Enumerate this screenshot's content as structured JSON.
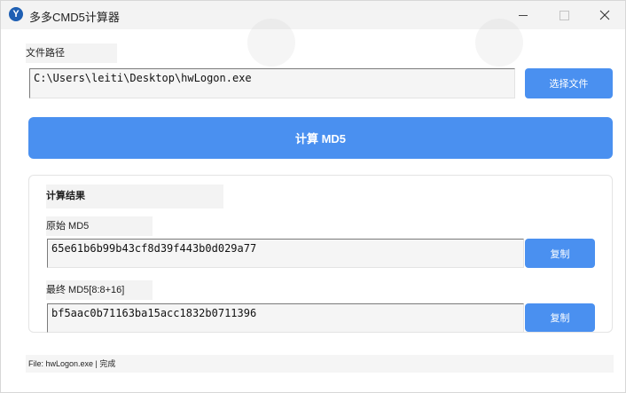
{
  "window": {
    "title": "多多CMD5计算器",
    "icon_letter": "Y"
  },
  "file_path": {
    "label": "文件路径",
    "value": "C:\\Users\\leiti\\Desktop\\hwLogon.exe",
    "browse_label": "选择文件"
  },
  "compute_button": {
    "label": "计算 MD5"
  },
  "results": {
    "title": "计算结果",
    "original": {
      "label": "原始 MD5",
      "value": "65e61b6b99b43cf8d39f443b0d029a77",
      "copy_label": "复制"
    },
    "final": {
      "label": "最终 MD5[8:8+16]",
      "value": "bf5aac0b71163ba15acc1832b0711396",
      "copy_label": "复制"
    }
  },
  "status": {
    "text": "File: hwLogon.exe | 完成"
  },
  "colors": {
    "accent": "#4a90f0",
    "window_bg": "#f3f3f3"
  },
  "icons": {
    "minimize": "minimize-icon",
    "maximize": "maximize-icon",
    "close": "close-icon"
  }
}
